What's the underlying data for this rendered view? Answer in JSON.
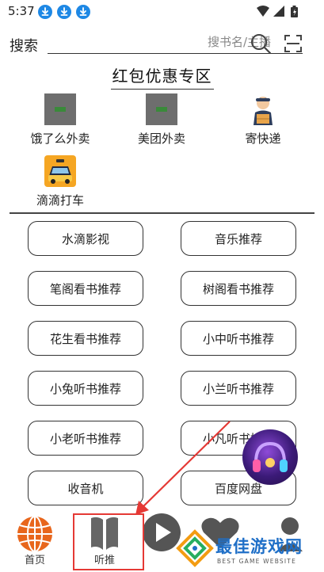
{
  "status_bar": {
    "time": "5:37",
    "download_count": 3
  },
  "search": {
    "label": "搜索",
    "placeholder": "搜书名/主播"
  },
  "promo": {
    "title": "红包优惠专区",
    "items": [
      {
        "label": "饿了么外卖",
        "icon": "eleme-placeholder-icon"
      },
      {
        "label": "美团外卖",
        "icon": "meituan-placeholder-icon"
      },
      {
        "label": "寄快递",
        "icon": "courier-icon"
      },
      {
        "label": "滴滴打车",
        "icon": "taxi-icon"
      }
    ]
  },
  "links": [
    "水滴影视",
    "音乐推荐",
    "笔阁看书推荐",
    "树阁看书推荐",
    "花生看书推荐",
    "小中听书推荐",
    "小兔听书推荐",
    "小兰听书推荐",
    "小老听书推荐",
    "小凡听书推荐",
    "收音机",
    "百度网盘"
  ],
  "bottom_nav": [
    {
      "label": "首页",
      "icon": "globe-icon"
    },
    {
      "label": "听推",
      "icon": "book-icon"
    },
    {
      "label": "",
      "icon": "play-icon"
    },
    {
      "label": "",
      "icon": "heart-icon"
    },
    {
      "label": "",
      "icon": "profile-icon"
    }
  ],
  "watermark": {
    "title": "最佳游戏网",
    "subtitle": "BEST GAME WEBSITE"
  },
  "colors": {
    "accent_red": "#e53935",
    "download_blue": "#1e88e5",
    "nav_orange": "#e8661c",
    "nav_gray": "#666666",
    "watermark_blue": "#1f6fc7"
  }
}
